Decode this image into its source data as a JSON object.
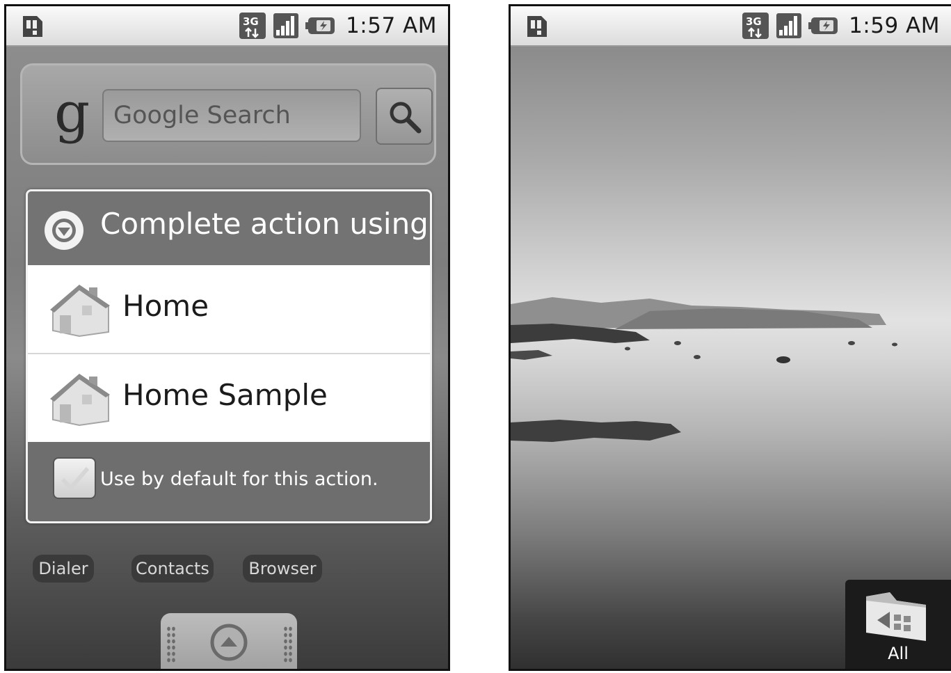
{
  "left_screen": {
    "status_bar": {
      "network": "3G",
      "time": "1:57 AM"
    },
    "search_widget": {
      "logo_text": "g",
      "placeholder": "Google Search"
    },
    "dialog": {
      "title": "Complete action using",
      "options": [
        {
          "label": "Home",
          "icon": "home-icon"
        },
        {
          "label": "Home Sample",
          "icon": "home-icon"
        }
      ],
      "default_checkbox_label": "Use by default for this action.",
      "default_checked": false
    },
    "dock": {
      "items": [
        "Dialer",
        "Contacts",
        "Browser"
      ]
    }
  },
  "right_screen": {
    "status_bar": {
      "network": "3G",
      "time": "1:59 AM"
    },
    "launcher_button": {
      "label": "All"
    }
  }
}
